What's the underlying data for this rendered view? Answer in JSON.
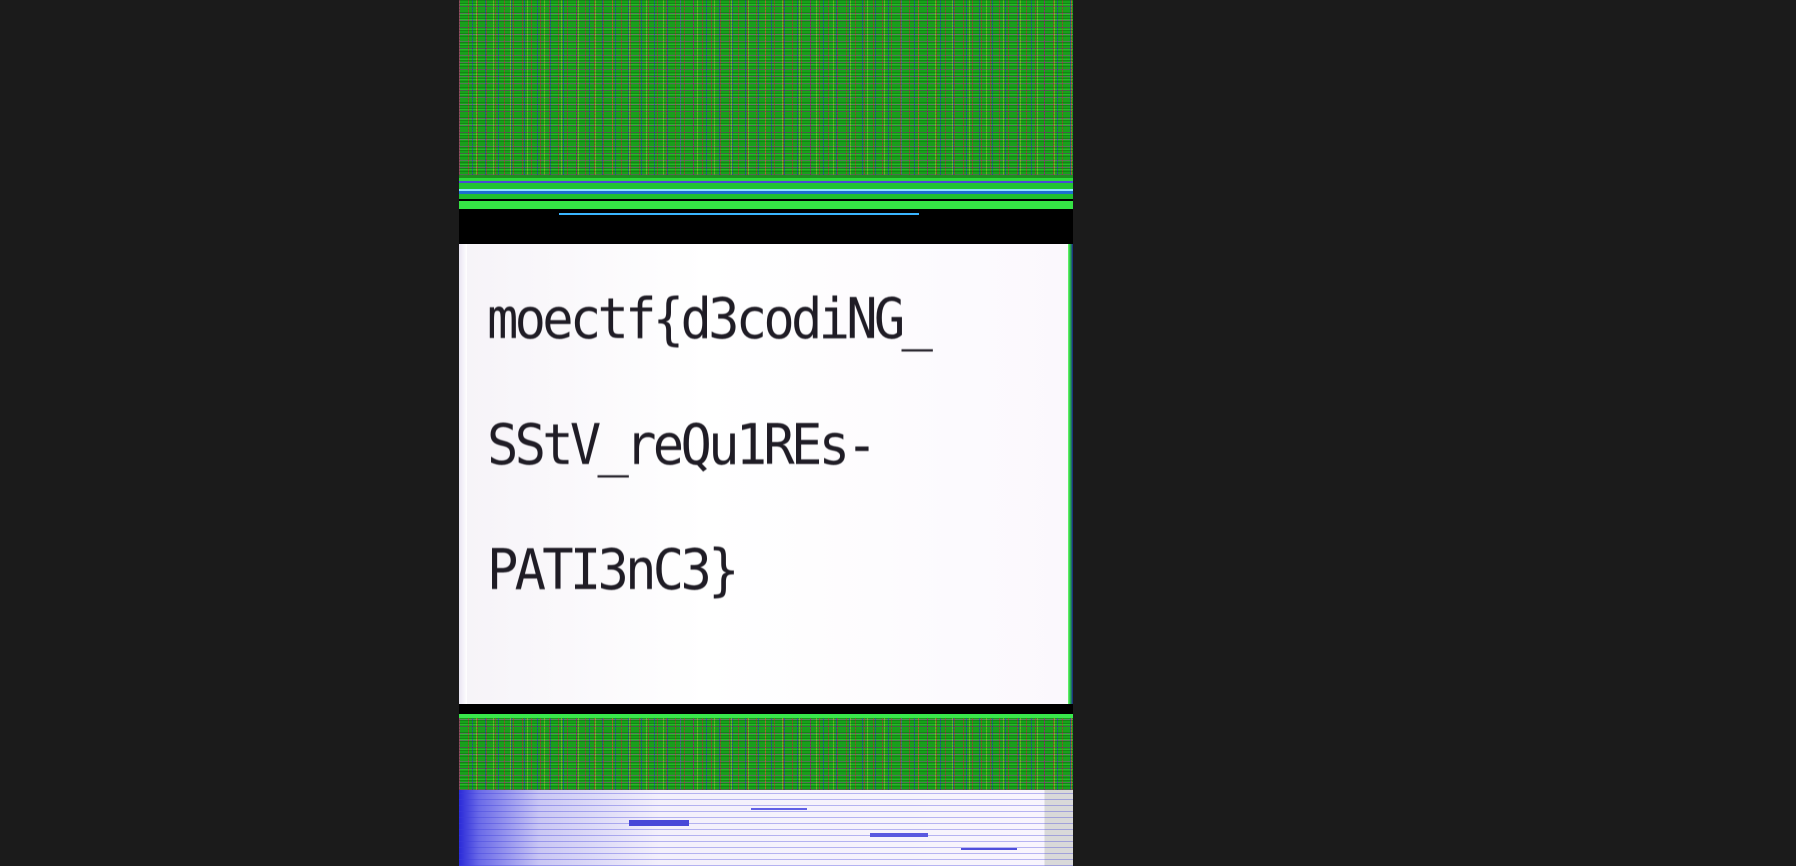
{
  "decoded_text": {
    "line1": "moectf{d3codiNG_",
    "line2": "SStV_reQu1REs-",
    "line3": "PATI3nC3}"
  }
}
